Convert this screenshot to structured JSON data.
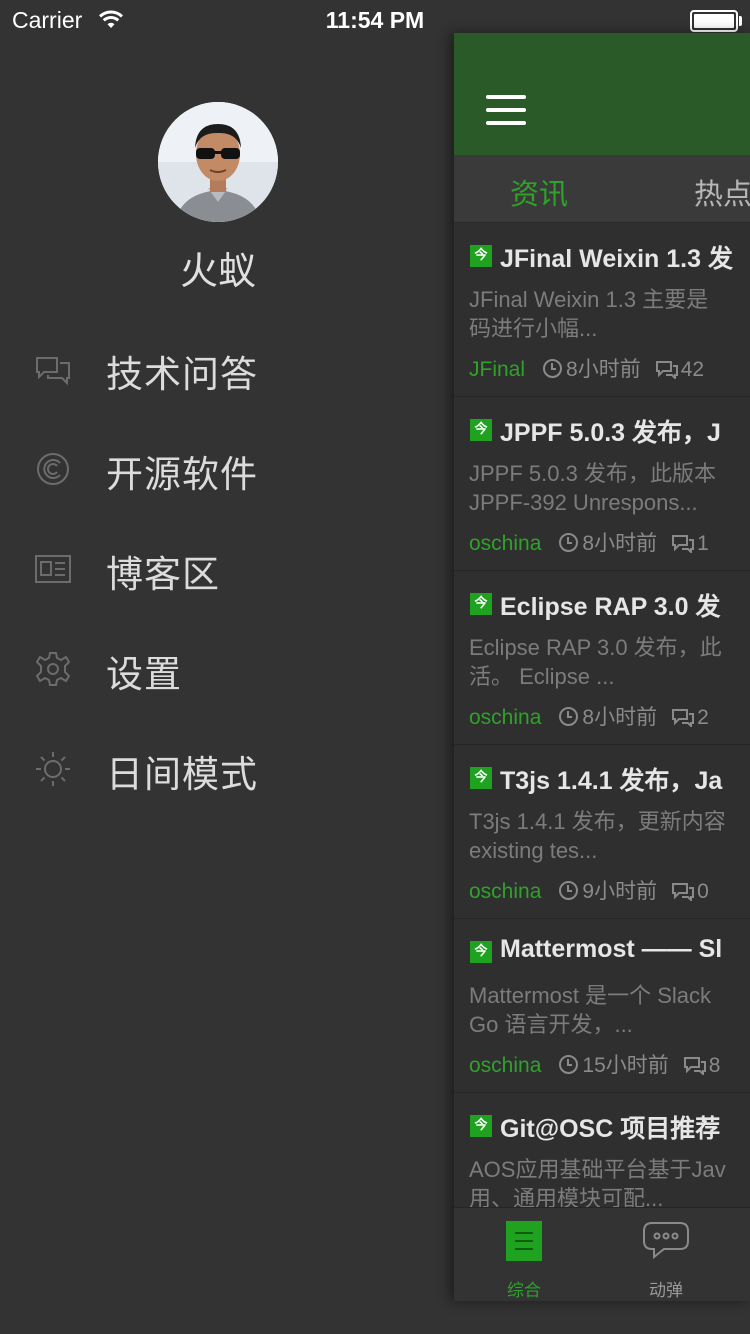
{
  "status_bar": {
    "carrier": "Carrier",
    "time": "11:54 PM"
  },
  "drawer": {
    "username": "火蚁",
    "menu": [
      {
        "label": "技术问答",
        "icon": "qa-chat-icon"
      },
      {
        "label": "开源软件",
        "icon": "copyright-icon"
      },
      {
        "label": "博客区",
        "icon": "blog-card-icon"
      },
      {
        "label": "设置",
        "icon": "gear-icon"
      },
      {
        "label": "日间模式",
        "icon": "sun-icon"
      }
    ]
  },
  "main": {
    "tabs": [
      {
        "label": "资讯",
        "active": true
      },
      {
        "label": "热点",
        "active": false
      }
    ],
    "news": [
      {
        "title": "JFinal Weixin 1.3 发",
        "summary_lines": [
          "JFinal Weixin 1.3 主要是",
          "码进行小幅..."
        ],
        "author": "JFinal",
        "time": "8小时前",
        "comments": "42"
      },
      {
        "title": "JPPF 5.0.3 发布，J",
        "summary_lines": [
          "JPPF 5.0.3 发布，此版本",
          "JPPF-392 Unrespons..."
        ],
        "author": "oschina",
        "time": "8小时前",
        "comments": "1"
      },
      {
        "title": "Eclipse RAP 3.0 发",
        "summary_lines": [
          "Eclipse RAP 3.0 发布，此",
          "活。 Eclipse ..."
        ],
        "author": "oschina",
        "time": "8小时前",
        "comments": "2"
      },
      {
        "title": "T3js 1.4.1 发布，Ja",
        "summary_lines": [
          "T3js 1.4.1 发布，更新内容",
          "existing tes..."
        ],
        "author": "oschina",
        "time": "9小时前",
        "comments": "0"
      },
      {
        "title": "Mattermost —— Sl",
        "summary_lines": [
          "Mattermost 是一个 Slack",
          "Go 语言开发，..."
        ],
        "author": "oschina",
        "time": "15小时前",
        "comments": "8"
      },
      {
        "title": "Git@OSC 项目推荐",
        "summary_lines": [
          "AOS应用基础平台基于Jav",
          "用、通用模块可配..."
        ],
        "author": "",
        "time": "",
        "comments": ""
      }
    ],
    "tabbar": [
      {
        "label": "综合",
        "icon": "list-doc-icon",
        "active": true
      },
      {
        "label": "动弹",
        "icon": "speech-bubble-icon",
        "active": false
      }
    ]
  },
  "colors": {
    "accent_green": "#2fa22a",
    "navbar_green": "#2a5a27",
    "drawer_bg": "#333333"
  }
}
